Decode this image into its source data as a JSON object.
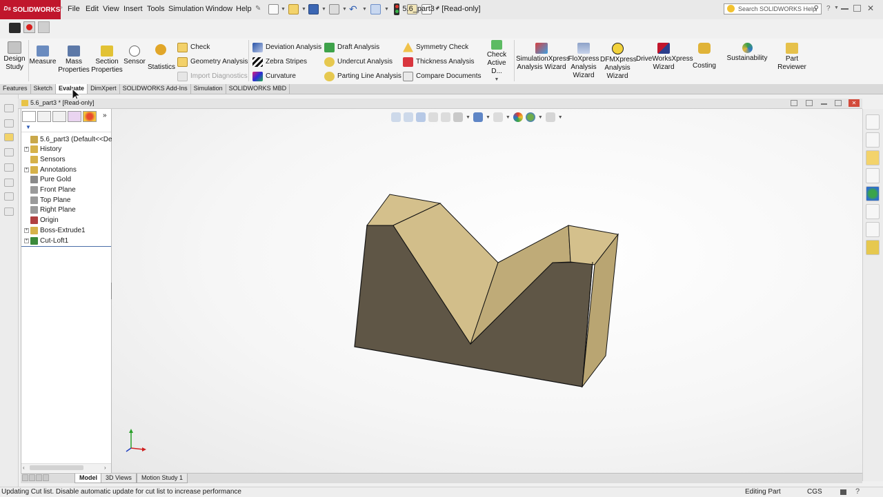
{
  "app": {
    "brand": "SOLIDWORKS",
    "doc_title": "5.6_part3 * [Read-only]",
    "search_placeholder": "Search SOLIDWORKS Help"
  },
  "menu": [
    "File",
    "Edit",
    "View",
    "Insert",
    "Tools",
    "Simulation",
    "Window",
    "Help"
  ],
  "ribbon": {
    "big_left": [
      {
        "label": "Design Study",
        "icon": "design-study-icon"
      },
      {
        "label": "Measure",
        "icon": "measure-icon"
      },
      {
        "label": "Mass Properties",
        "icon": "mass-properties-icon"
      },
      {
        "label": "Section Properties",
        "icon": "section-properties-icon"
      },
      {
        "label": "Sensor",
        "icon": "sensor-icon"
      },
      {
        "label": "Statistics",
        "icon": "statistics-icon"
      }
    ],
    "col1": [
      {
        "label": "Check",
        "disabled": false
      },
      {
        "label": "Geometry Analysis",
        "disabled": false
      },
      {
        "label": "Import Diagnostics",
        "disabled": true
      }
    ],
    "col2": [
      {
        "label": "Deviation Analysis"
      },
      {
        "label": "Zebra Stripes"
      },
      {
        "label": "Curvature"
      }
    ],
    "col3": [
      {
        "label": "Draft Analysis"
      },
      {
        "label": "Undercut Analysis"
      },
      {
        "label": "Parting Line Analysis"
      }
    ],
    "col4": [
      {
        "label": "Symmetry Check"
      },
      {
        "label": "Thickness Analysis"
      },
      {
        "label": "Compare Documents"
      }
    ],
    "check_active": "Check Active D...",
    "big_right": [
      {
        "label": "SimulationXpress Analysis Wizard"
      },
      {
        "label": "FloXpress Analysis Wizard"
      },
      {
        "label": "DFMXpress Analysis Wizard"
      },
      {
        "label": "DriveWorksXpress Wizard"
      },
      {
        "label": "Costing"
      },
      {
        "label": "Sustainability"
      },
      {
        "label": "Part Reviewer"
      }
    ]
  },
  "tabs": [
    {
      "label": "Features",
      "active": false
    },
    {
      "label": "Sketch",
      "active": false
    },
    {
      "label": "Evaluate",
      "active": true
    },
    {
      "label": "DimXpert",
      "active": false
    },
    {
      "label": "SOLIDWORKS Add-Ins",
      "active": false
    },
    {
      "label": "Simulation",
      "active": false
    },
    {
      "label": "SOLIDWORKS MBD",
      "active": false
    }
  ],
  "doc_header": "5.6_part3 * [Read-only]",
  "tree": [
    {
      "label": "5.6_part3  (Default<<De",
      "expandable": false,
      "icon_color": "#c9a84a"
    },
    {
      "label": "History",
      "expandable": true,
      "icon_color": "#d6b24a"
    },
    {
      "label": "Sensors",
      "expandable": false,
      "icon_color": "#d6b24a"
    },
    {
      "label": "Annotations",
      "expandable": true,
      "icon_color": "#d6b24a"
    },
    {
      "label": "Pure Gold",
      "expandable": false,
      "icon_color": "#8a8a8a"
    },
    {
      "label": "Front Plane",
      "expandable": false,
      "icon_color": "#9a9a9a"
    },
    {
      "label": "Top Plane",
      "expandable": false,
      "icon_color": "#9a9a9a"
    },
    {
      "label": "Right Plane",
      "expandable": false,
      "icon_color": "#9a9a9a"
    },
    {
      "label": "Origin",
      "expandable": false,
      "icon_color": "#b04040"
    },
    {
      "label": "Boss-Extrude1",
      "expandable": true,
      "icon_color": "#d6b24a"
    },
    {
      "label": "Cut-Loft1",
      "expandable": true,
      "icon_color": "#3b8a3b"
    }
  ],
  "bottom_tabs": [
    {
      "label": "Model",
      "active": true
    },
    {
      "label": "3D Views",
      "active": false
    },
    {
      "label": "Motion Study 1",
      "active": false
    }
  ],
  "status": {
    "message": "Updating Cut list. Disable automatic update for cut list to increase performance",
    "mode": "Editing Part",
    "units": "CGS"
  },
  "colors": {
    "brand_red": "#c0162c",
    "part_top": "#d4c08c",
    "part_side": "#5f5646",
    "part_right": "#b9a572"
  }
}
